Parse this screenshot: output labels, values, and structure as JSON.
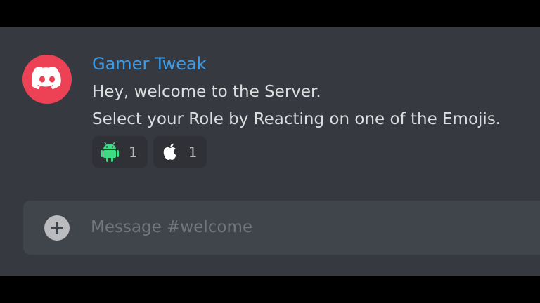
{
  "message": {
    "author": "Gamer Tweak",
    "lines": [
      "Hey, welcome to the Server.",
      "Select your Role by Reacting on one of the Emojis."
    ],
    "author_color": "#3b9be6",
    "avatar_color": "#ed4255",
    "avatar_icon": "discord-logo-icon"
  },
  "reactions": [
    {
      "icon": "android-icon",
      "count": "1",
      "color": "#3ddc84"
    },
    {
      "icon": "apple-icon",
      "count": "1",
      "color": "#ffffff"
    }
  ],
  "composer": {
    "placeholder": "Message #welcome",
    "add_icon": "plus-circle-icon"
  },
  "theme": {
    "background": "#36393f",
    "composer_background": "#40444b",
    "text_color": "#dcddde"
  }
}
